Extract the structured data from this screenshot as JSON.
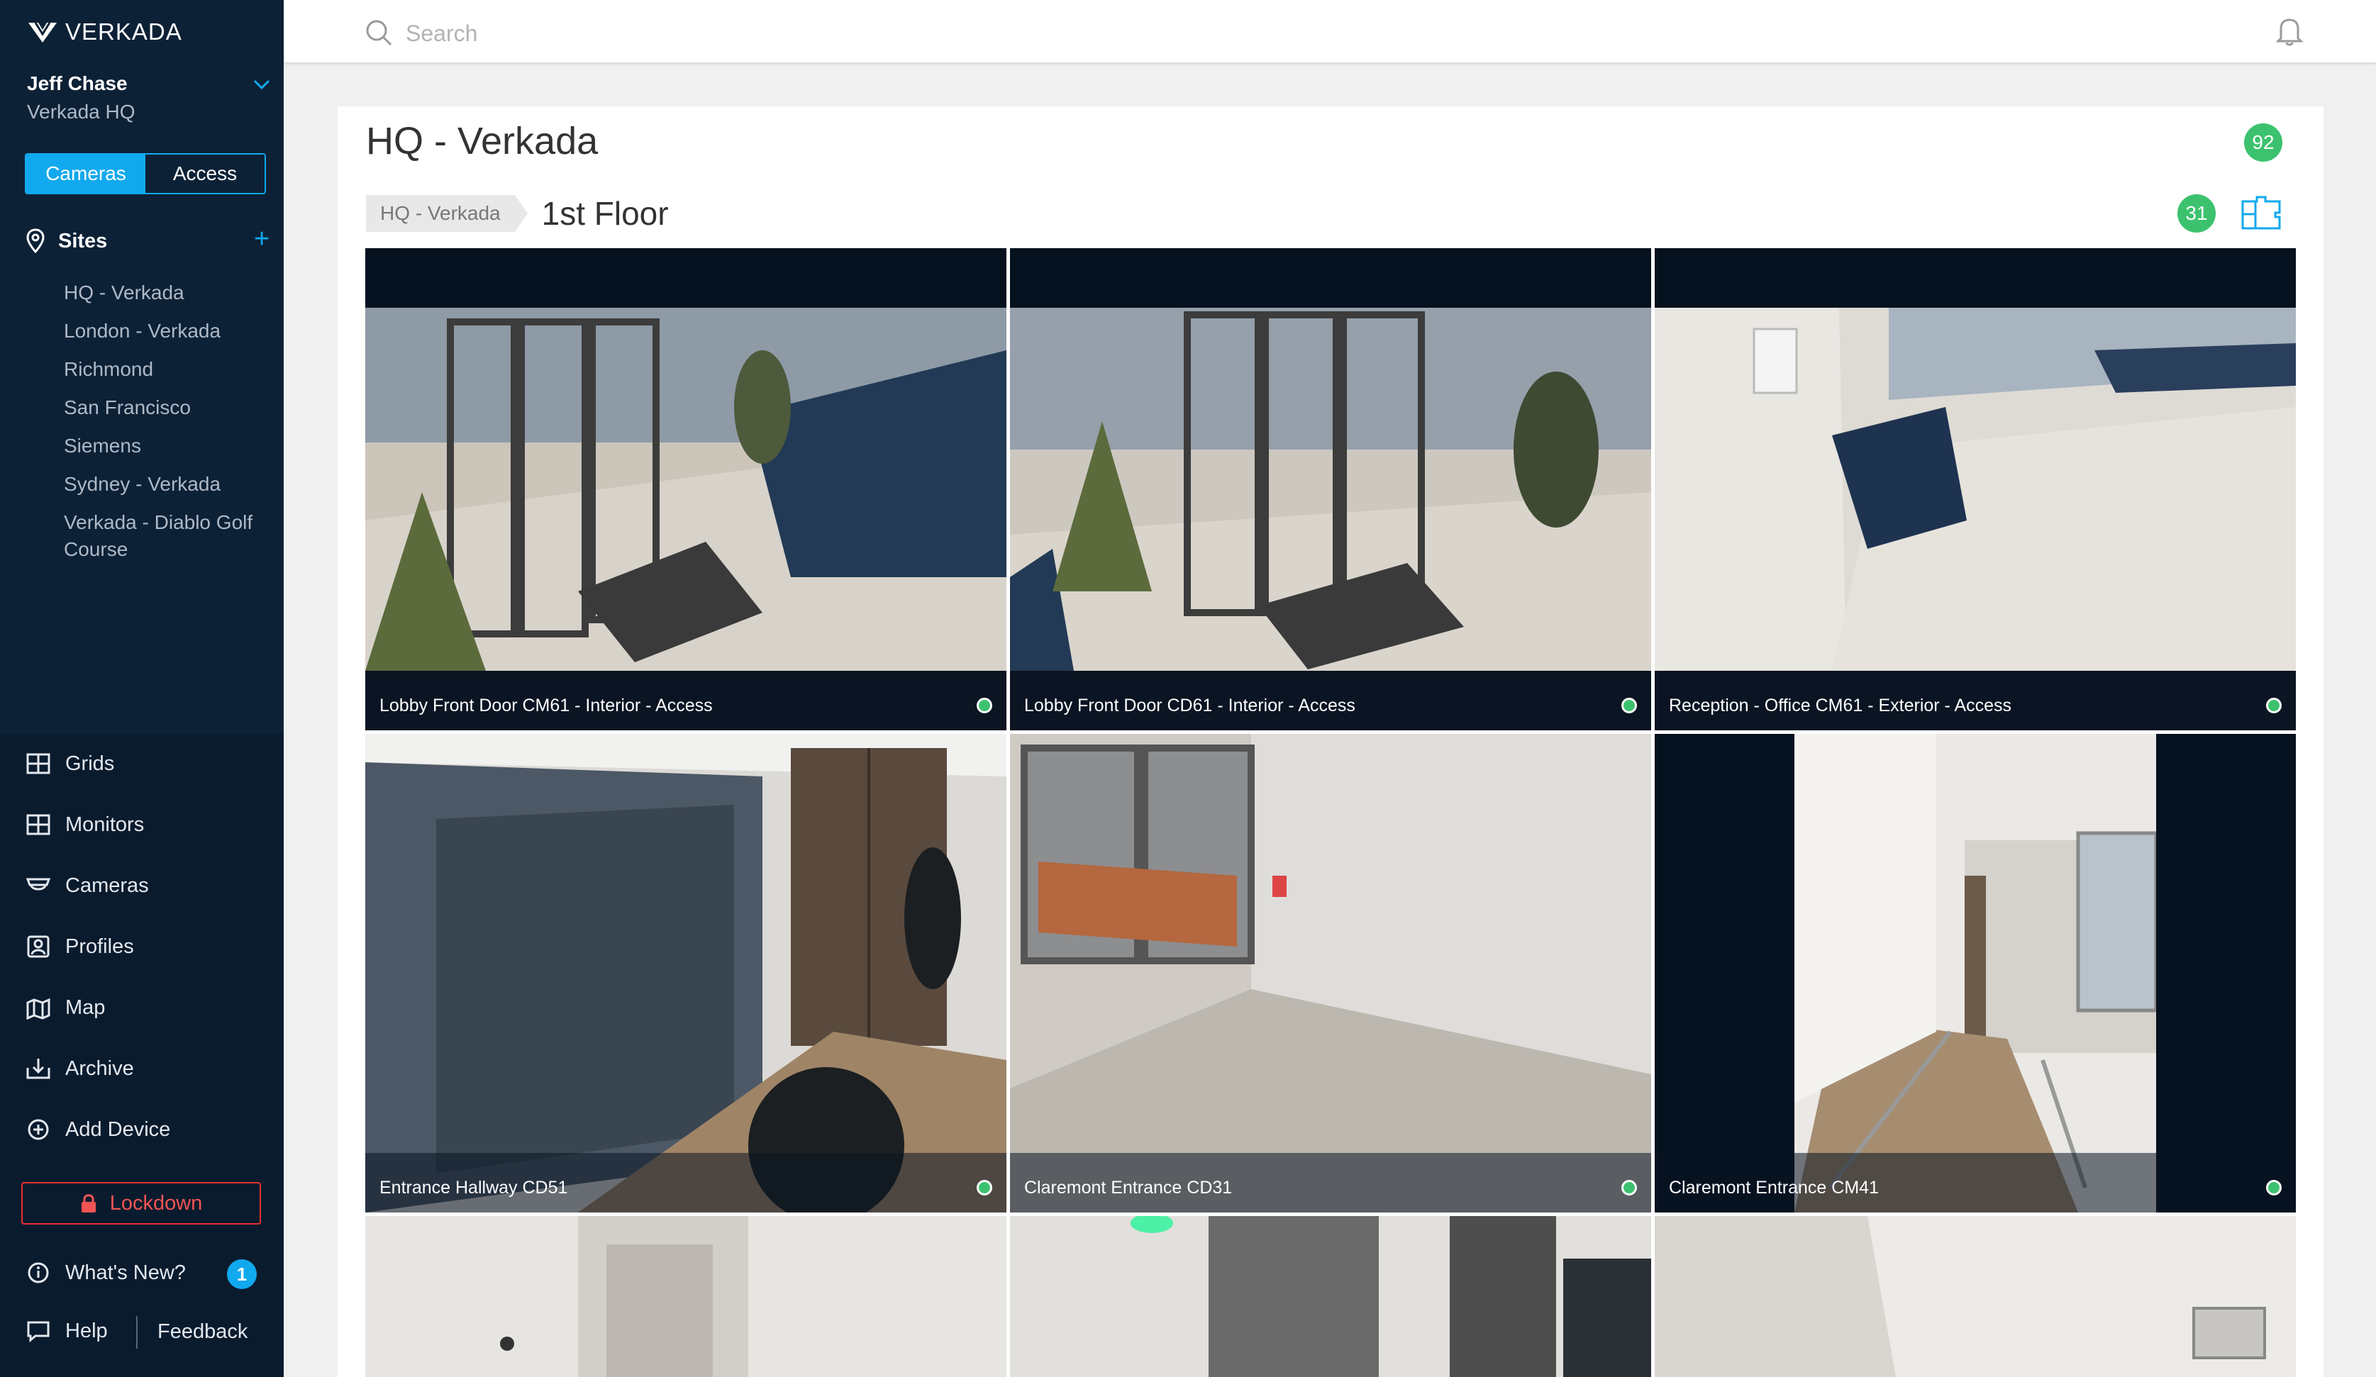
{
  "app": {
    "brand": "VERKADA",
    "accent_color": "#11a9ee",
    "status_color": "#3cc26e"
  },
  "user": {
    "name": "Jeff Chase",
    "org": "Verkada HQ"
  },
  "mode_toggle": {
    "options": [
      "Cameras",
      "Access"
    ],
    "selected": "Cameras"
  },
  "sites": {
    "heading": "Sites",
    "items": [
      "HQ - Verkada",
      "London - Verkada",
      "Richmond",
      "San Francisco",
      "Siemens",
      "Sydney - Verkada",
      "Verkada - Diablo Golf Course"
    ]
  },
  "nav": {
    "items": [
      {
        "label": "Grids",
        "icon": "grid-icon"
      },
      {
        "label": "Monitors",
        "icon": "monitor-icon"
      },
      {
        "label": "Cameras",
        "icon": "camera-icon"
      },
      {
        "label": "Profiles",
        "icon": "profile-icon"
      },
      {
        "label": "Map",
        "icon": "map-icon"
      },
      {
        "label": "Archive",
        "icon": "archive-icon"
      },
      {
        "label": "Add Device",
        "icon": "add-circle-icon"
      }
    ],
    "lockdown": "Lockdown",
    "whats_new": "What's New?",
    "whats_new_count": "1",
    "help": "Help",
    "feedback": "Feedback"
  },
  "search": {
    "placeholder": "Search"
  },
  "page": {
    "title": "HQ - Verkada",
    "title_count": "92",
    "breadcrumb": "HQ - Verkada",
    "floor": "1st Floor",
    "floor_count": "31"
  },
  "cameras": [
    {
      "name": "Lobby Front Door CM61 - Interior - Access",
      "status": "online"
    },
    {
      "name": "Lobby Front Door CD61 - Interior - Access",
      "status": "online"
    },
    {
      "name": "Reception - Office CM61 - Exterior - Access",
      "status": "online"
    },
    {
      "name": "Entrance Hallway CD51",
      "status": "online"
    },
    {
      "name": "Claremont Entrance CD31",
      "status": "online"
    },
    {
      "name": "Claremont Entrance CM41",
      "status": "online"
    },
    {
      "name": "",
      "status": ""
    },
    {
      "name": "",
      "status": ""
    },
    {
      "name": "",
      "status": ""
    }
  ]
}
